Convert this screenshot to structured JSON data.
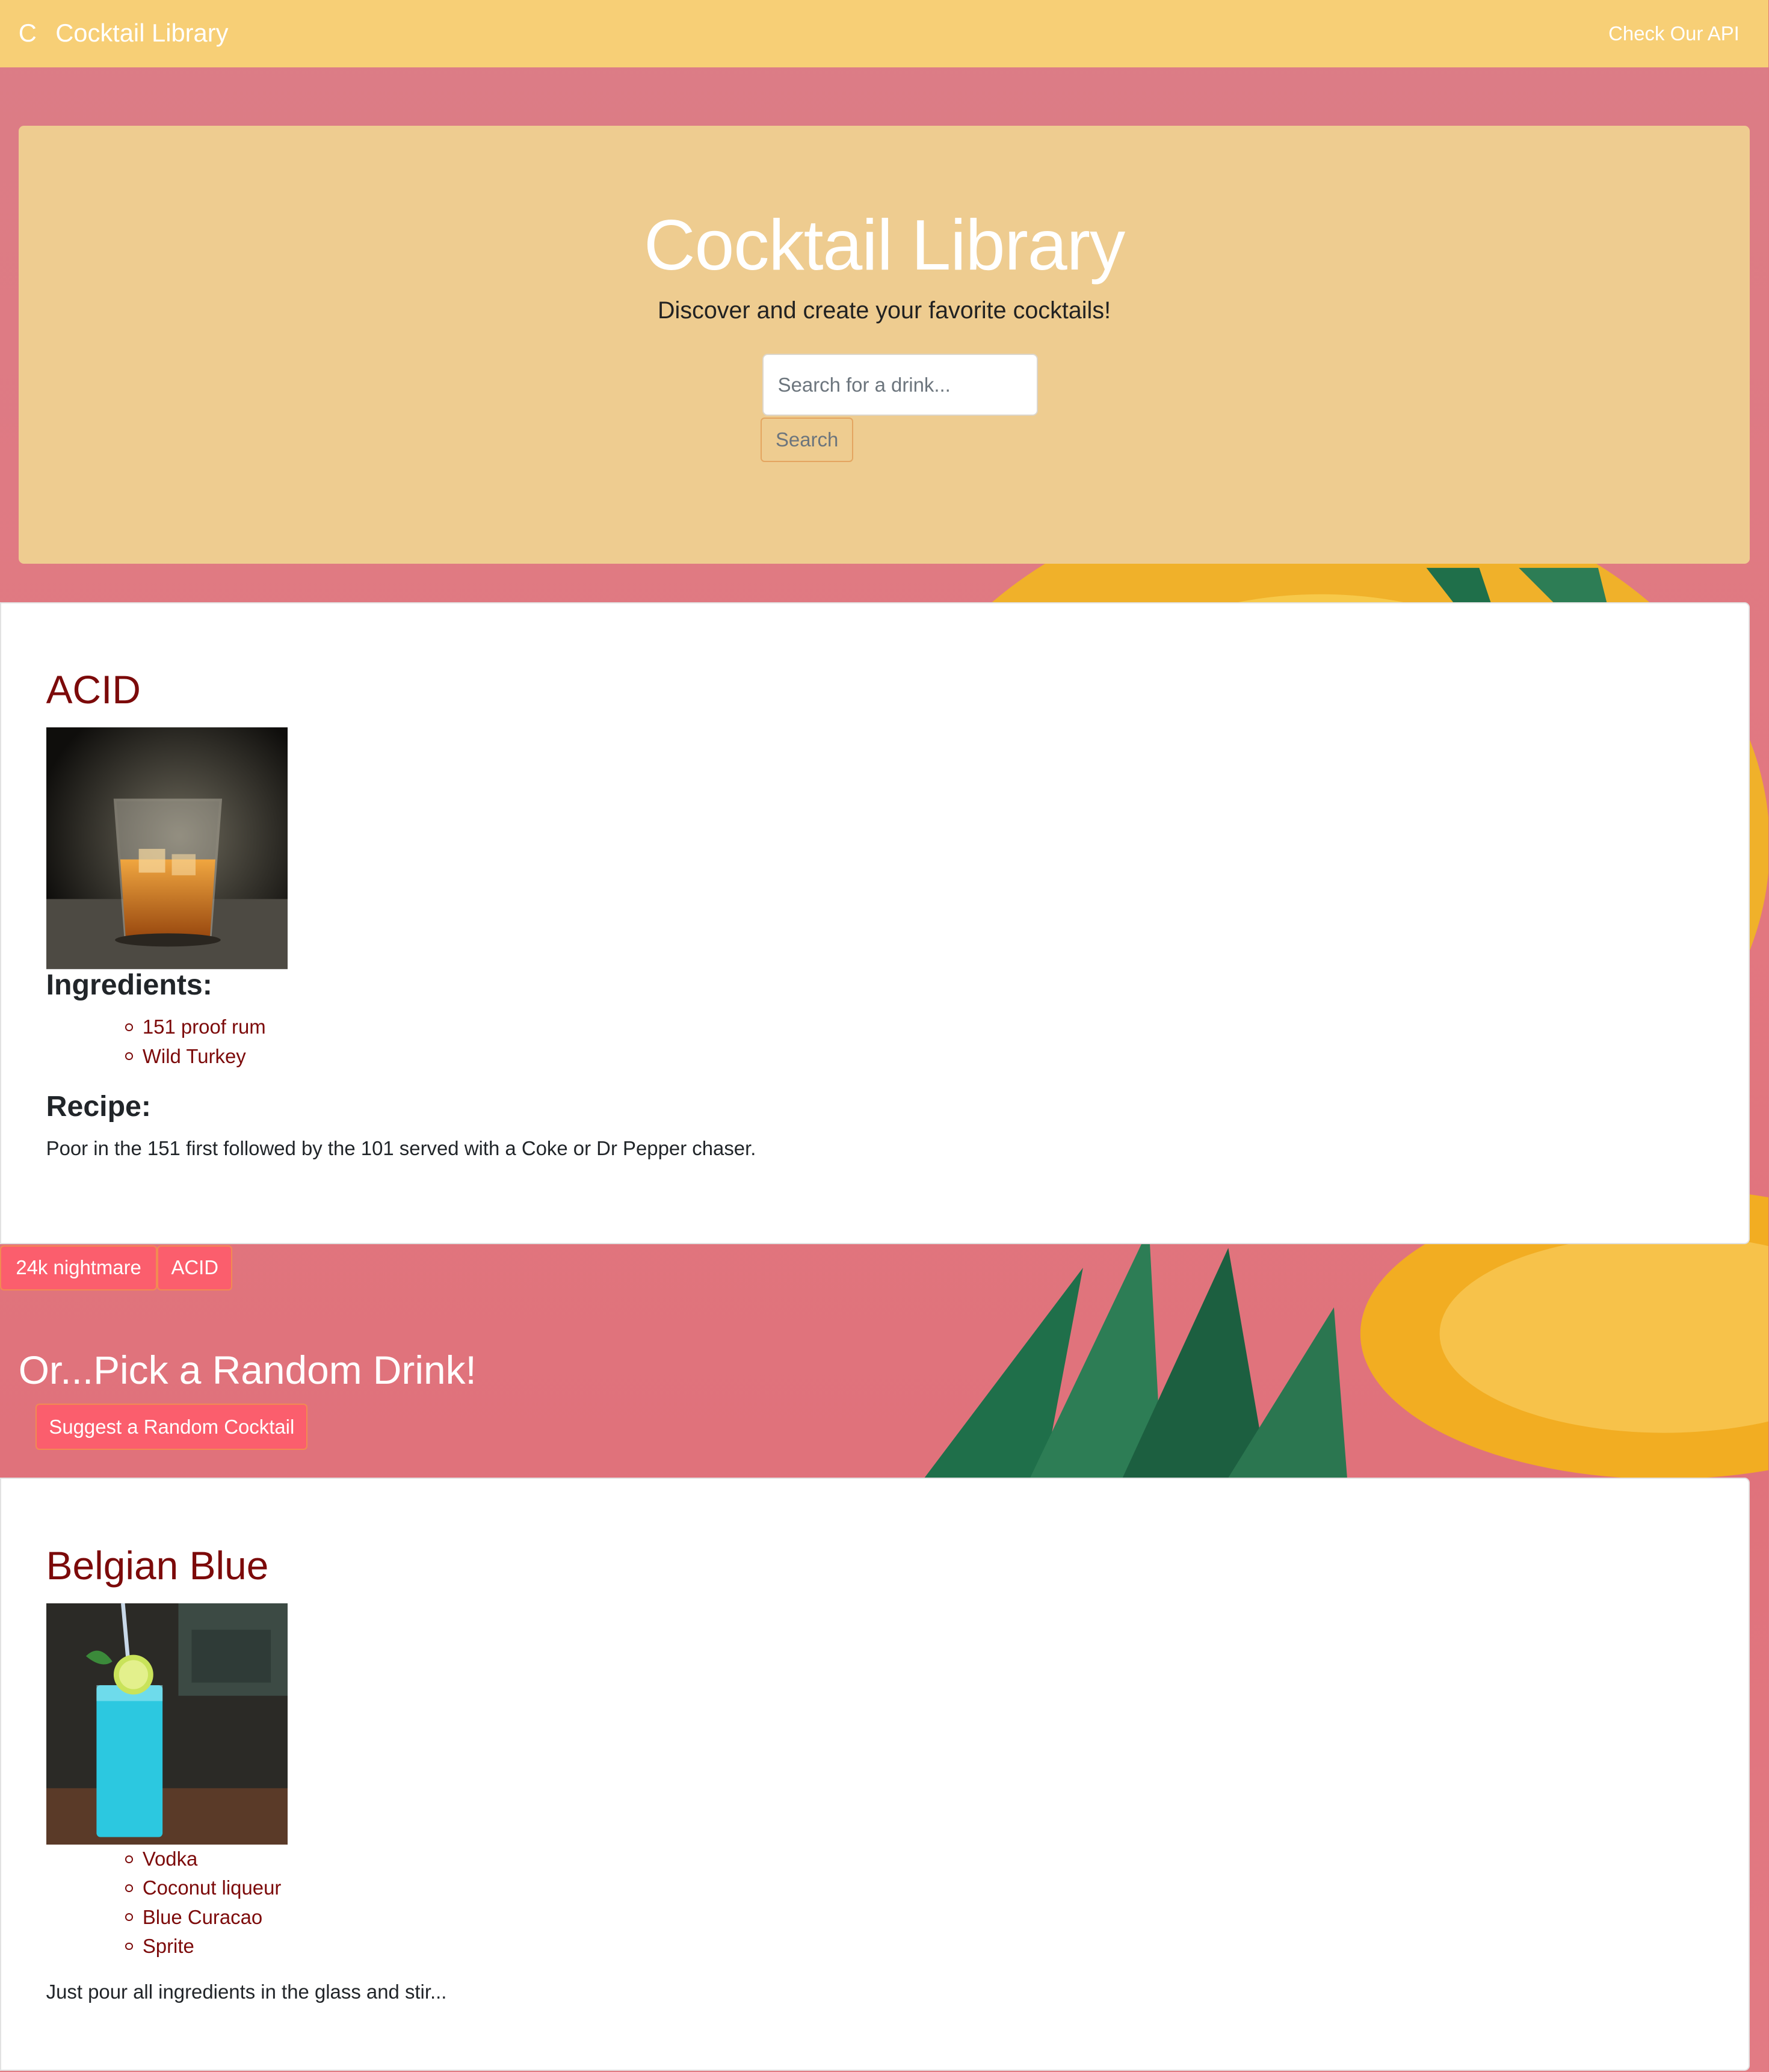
{
  "navbar": {
    "brand_mark": "C",
    "brand": "Cocktail Library",
    "api_link": "Check Our API"
  },
  "hero": {
    "title": "Cocktail Library",
    "subtitle": "Discover and create your favorite cocktails!",
    "search_placeholder": "Search for a drink...",
    "search_button": "Search"
  },
  "drinks": [
    {
      "name": "ACID",
      "image_icon": "whiskey-glass-photo",
      "ingredients_heading": "Ingredients:",
      "ingredients": [
        "151 proof rum",
        "Wild Turkey"
      ],
      "recipe_heading": "Recipe:",
      "recipe": "Poor in the 151 first followed by the 101 served with a Coke or Dr Pepper chaser."
    },
    {
      "name": "Belgian Blue",
      "image_icon": "blue-cocktail-photo",
      "ingredients": [
        "Vodka",
        "Coconut liqueur",
        "Blue Curacao",
        "Sprite"
      ],
      "recipe": "Just pour all ingredients in the glass and stir..."
    }
  ],
  "history_tags": [
    "24k nightmare",
    "ACID"
  ],
  "random": {
    "heading": "Or...Pick a Random Drink!",
    "button": "Suggest a Random Cocktail"
  },
  "colors": {
    "navbar": "#f7cf76",
    "hero": "#eecc90",
    "background": "#e07781",
    "drink_name": "#7c0a0a",
    "button": "#fb5e6d"
  }
}
